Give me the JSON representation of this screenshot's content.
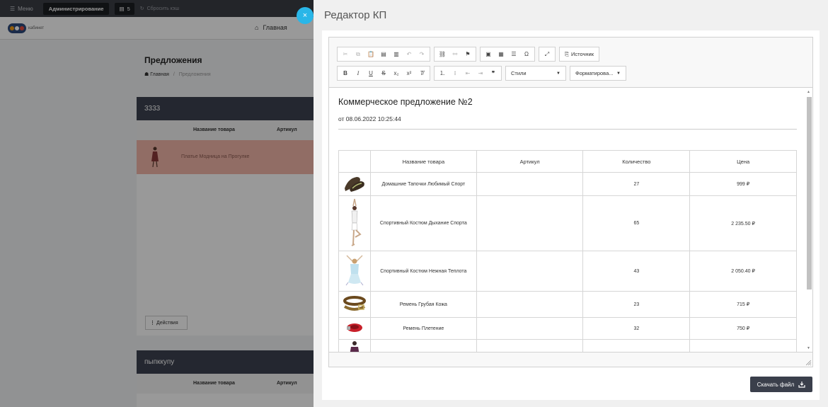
{
  "topbar": {
    "menu_label": "Меню",
    "admin_label": "Администрирование",
    "count": "5",
    "reset_label": "Сбросить кэш"
  },
  "header": {
    "logo_text": "кабинет",
    "home_label": "Главная"
  },
  "background": {
    "title": "Предложения",
    "breadcrumb": {
      "home": "Главная",
      "sep": "/",
      "current": "Предложения"
    },
    "cards": [
      {
        "name": "3333",
        "columns": [
          "Название товара",
          "Артикул"
        ],
        "rows": [
          {
            "name": "Платье Модница на Прогулке"
          }
        ]
      },
      {
        "name": "пыпккупу",
        "columns": [
          "Название товара",
          "Артикул"
        ]
      }
    ],
    "actions_label": "Действия"
  },
  "modal": {
    "title": "Редактор КП",
    "close_symbol": "×",
    "download_label": "Скачать файл"
  },
  "editor": {
    "toolbar": {
      "source_label": "Источник",
      "styles_label": "Стили",
      "format_label": "Форматирова..."
    },
    "document": {
      "title": "Коммерческое предложение №2",
      "date": "от 08.06.2022 10:25:44",
      "table": {
        "headers": [
          "",
          "Название товара",
          "Артикул",
          "Количество",
          "Цена"
        ],
        "rows": [
          {
            "image": "slippers-icon",
            "name": "Домашние Тапочки Любимый Спорт",
            "article": "",
            "qty": "27",
            "price": "999 ₽"
          },
          {
            "image": "yoga-suit-icon",
            "name": "Спортивный Костюм Дыхание Спорта",
            "article": "",
            "qty": "65",
            "price": "2 235.50 ₽"
          },
          {
            "image": "tender-suit-icon",
            "name": "Спортивный Костюм Нежная Теплота",
            "article": "",
            "qty": "43",
            "price": "2 050.40 ₽"
          },
          {
            "image": "leather-belt-icon",
            "name": "Ремень Грубая Кожа",
            "article": "",
            "qty": "23",
            "price": "715 ₽"
          },
          {
            "image": "woven-belt-icon",
            "name": "Ремень Плетение",
            "article": "",
            "qty": "32",
            "price": "750 ₽"
          },
          {
            "image": "dress-icon",
            "name": "",
            "article": "",
            "qty": "",
            "price": ""
          }
        ]
      }
    }
  }
}
